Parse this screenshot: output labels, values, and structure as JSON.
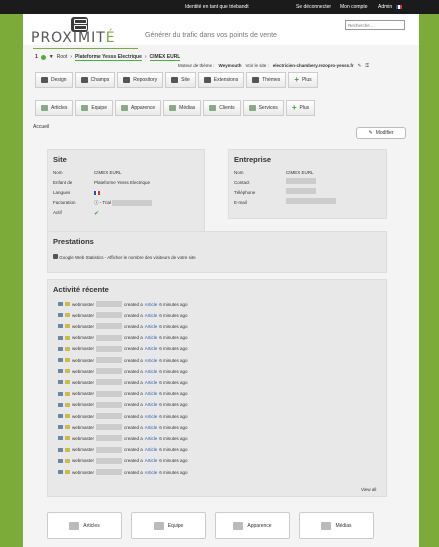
{
  "topbar": {
    "identity": "Identité en tant que triebandt",
    "logout": "Se déconnecter",
    "account": "Mon compte",
    "admin": "Admin"
  },
  "brand": {
    "name_pre": "PROXIMIT",
    "name_post": "É",
    "tagline": "Générer du trafic dans vos points de vente"
  },
  "search": {
    "placeholder": "Recherche ..."
  },
  "breadcrumb": {
    "count": "1",
    "root": "Root",
    "parent": "Plateforme Yesss Electrique",
    "current": "CIMEX EURL"
  },
  "subline": {
    "engine_label": "Moteur de thème :",
    "engine": "Weymouth",
    "site_label": "Voir le site :",
    "site_url": "electricien-chambery.rezopro-yesss.fr"
  },
  "toolbar1": [
    "Design",
    "Champs",
    "Repository",
    "Site",
    "Extensions",
    "Thèmes",
    "Plus"
  ],
  "toolbar2": [
    "Articles",
    "Equipe",
    "Apparence",
    "Médias",
    "Clients",
    "Services",
    "Plus"
  ],
  "accueil": "Accueil",
  "modify": "Modifier",
  "site": {
    "title": "Site",
    "rows": [
      {
        "label": "Nom",
        "value": "CIMEX EURL"
      },
      {
        "label": "Enfant de",
        "value": "Plateforme Yesss Electrique"
      },
      {
        "label": "Langues",
        "value": ""
      },
      {
        "label": "Facturation",
        "value": "- Trial"
      },
      {
        "label": "Actif",
        "value": "✔"
      }
    ]
  },
  "entreprise": {
    "title": "Entreprise",
    "rows": [
      {
        "label": "Nom",
        "value": "CIMEX EURL"
      },
      {
        "label": "Contact",
        "value": ""
      },
      {
        "label": "Téléphone",
        "value": ""
      },
      {
        "label": "E-mail",
        "value": ""
      }
    ]
  },
  "prestations": {
    "title": "Prestations",
    "item": "Google Web Statistics - Afficher le nombre des visiteurs de votre site"
  },
  "activity": {
    "title": "Activité récente",
    "user": "webmaster",
    "verb": "created a",
    "link": "Article",
    "time": "6 minutes ago",
    "count": 16,
    "view_all": "View all"
  },
  "tiles": [
    "Articles",
    "Equipe",
    "Apparence",
    "Médias"
  ],
  "colors": {
    "accent": "#7dab3a",
    "link": "#2a57b8"
  }
}
